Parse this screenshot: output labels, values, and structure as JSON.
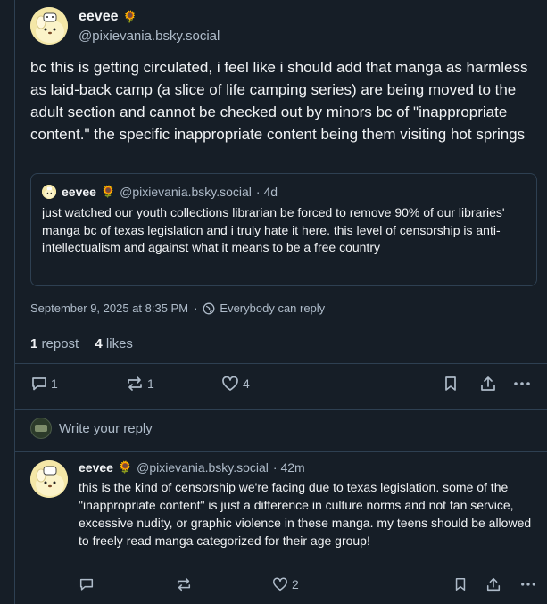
{
  "post": {
    "author_name": "eevee",
    "author_emoji": "🌻",
    "author_handle": "@pixievania.bsky.social",
    "text": "bc this is getting circulated, i feel like i should add that manga as harmless as laid-back camp (a slice of life camping series) are being moved to the adult section and cannot be checked out by minors bc of \"inappropriate content.\" the specific inappropriate content being them visiting hot springs",
    "quote": {
      "author_name": "eevee",
      "author_emoji": "🌻",
      "author_handle": "@pixievania.bsky.social",
      "age": "· 4d",
      "text": "just watched our youth collections librarian be forced to remove 90% of our libraries' manga bc of texas legislation and i truly hate it here. this level of censorship is anti-intellectualism and against what it means to be a free country"
    },
    "timestamp": "September 9, 2025 at 8:35 PM",
    "separator": "·",
    "visibility": "Everybody can reply",
    "repost_count": "1",
    "repost_label": "repost",
    "like_count": "4",
    "like_label": "likes",
    "actions": {
      "reply_count": "1",
      "repost_count": "1",
      "like_count": "4"
    }
  },
  "reply_composer": {
    "placeholder": "Write your reply"
  },
  "reply": {
    "author_name": "eevee",
    "author_emoji": "🌻",
    "author_handle": "@pixievania.bsky.social",
    "age": "· 42m",
    "text": "this is the kind of censorship we're facing due to texas legislation. some of the \"inappropriate content\" is just a difference in culture norms and not fan service, excessive nudity, or graphic violence in these manga. my teens should be allowed to freely read manga categorized for their age group!",
    "like_count": "2"
  },
  "colors": {
    "background": "#161e27",
    "border": "#2e4052",
    "text_primary": "#f1f3f5",
    "text_secondary": "#aebbc9"
  }
}
